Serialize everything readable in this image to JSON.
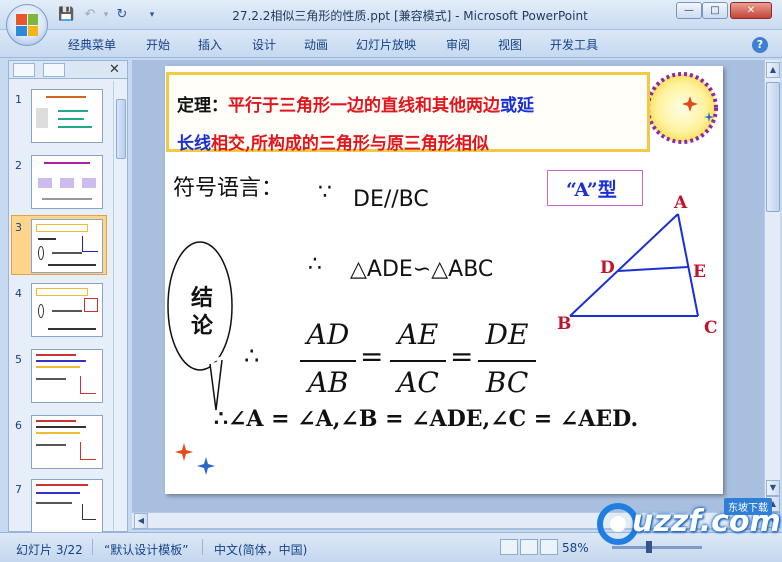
{
  "window": {
    "title": "27.2.2相似三角形的性质.ppt [兼容模式] - Microsoft PowerPoint"
  },
  "ribbon": {
    "tabs": [
      "经典菜单",
      "开始",
      "插入",
      "设计",
      "动画",
      "幻灯片放映",
      "审阅",
      "视图",
      "开发工具"
    ]
  },
  "thumbnails": [
    {
      "num": "1"
    },
    {
      "num": "2"
    },
    {
      "num": "3"
    },
    {
      "num": "4"
    },
    {
      "num": "5"
    },
    {
      "num": "6"
    },
    {
      "num": "7"
    }
  ],
  "slide": {
    "theorem_label": "定理：",
    "theorem_text1": "平行于三角形一边的直线和其他两边",
    "theorem_text1_blue": "或延",
    "theorem_text2_blue": "长线",
    "theorem_text2": "相交,所构成的三角形与原三角形相似",
    "symbol_label": "符号语言：",
    "because": "∵",
    "premise": "DE//BC",
    "therefore": "∴",
    "similar": "△ADE∽△ABC",
    "type_label": "“A”型",
    "conclusion": "结论",
    "fractions": [
      {
        "num": "AD",
        "den": "AB"
      },
      {
        "num": "AE",
        "den": "AC"
      },
      {
        "num": "DE",
        "den": "BC"
      }
    ],
    "equals": "=",
    "angles": "∴∠A = ∠A,∠B = ∠ADE,∠C = ∠AED.",
    "vertices": {
      "A": "A",
      "B": "B",
      "C": "C",
      "D": "D",
      "E": "E"
    },
    "triangle_color": "#1b2fd6"
  },
  "status": {
    "slide_info": "幻灯片 3/22",
    "template": "“默认设计模板”",
    "language": "中文(简体，中国)",
    "zoom": "58%"
  },
  "watermark": {
    "text": "uzzf.com",
    "badge": "东坡下载"
  }
}
